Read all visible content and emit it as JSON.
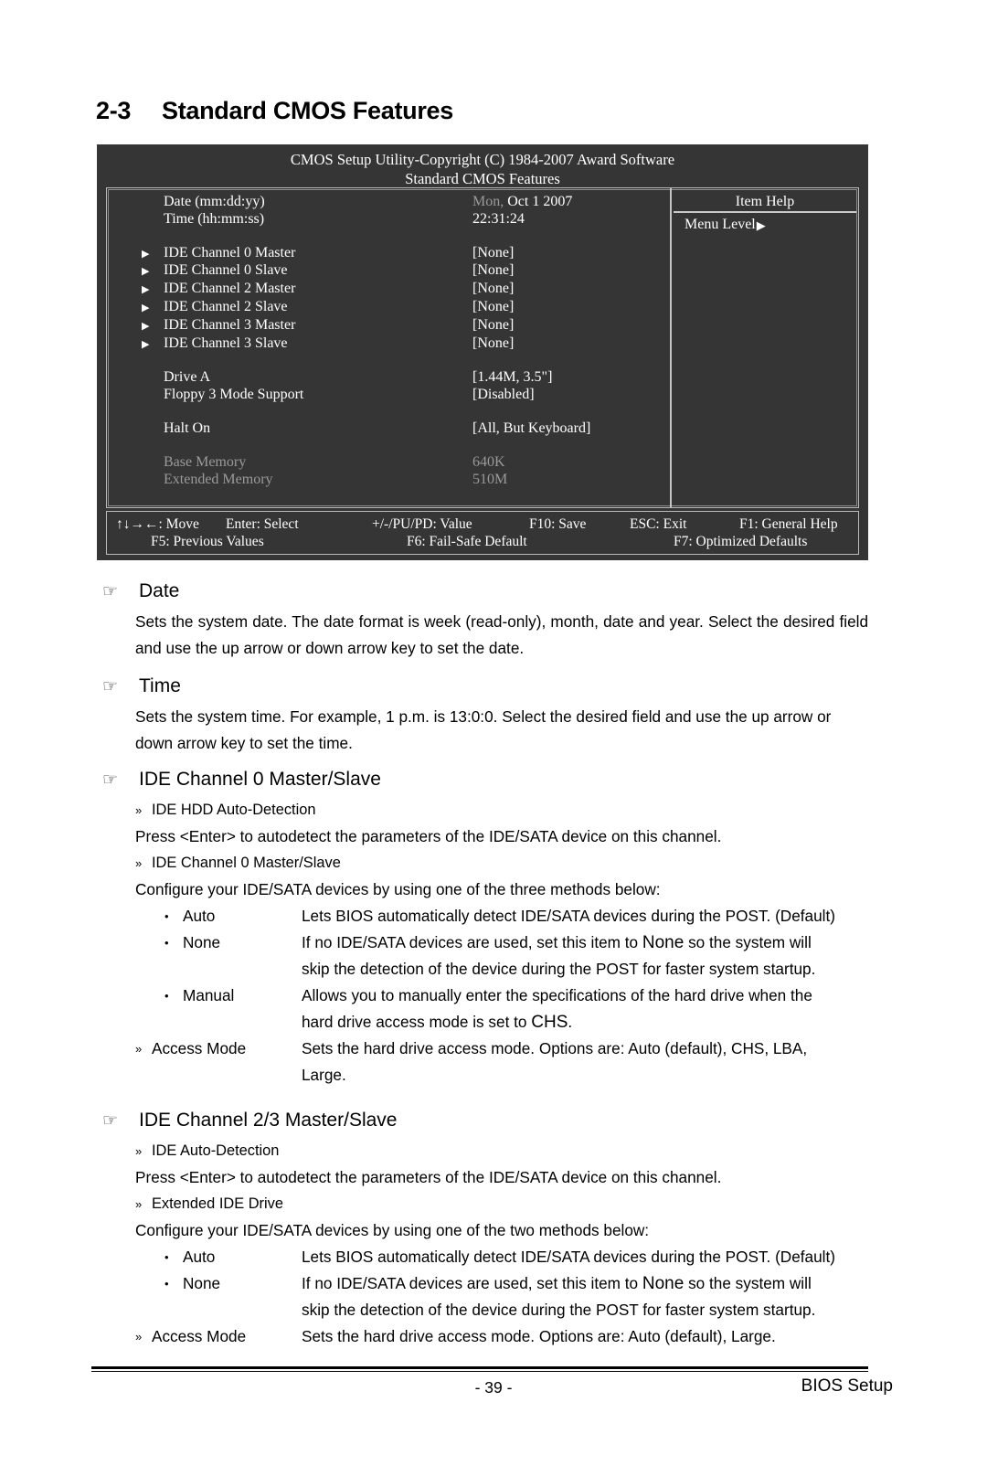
{
  "heading": {
    "number": "2-3",
    "title": "Standard CMOS Features"
  },
  "bios": {
    "title_line1": "CMOS Setup Utility-Copyright (C) 1984-2007 Award Software",
    "title_line2": "Standard CMOS Features",
    "rows": [
      {
        "marker": "",
        "label": "Date (mm:dd:yy)",
        "value_dim": "Mon,",
        "value": "Oct  1  2007"
      },
      {
        "marker": "",
        "label": "Time (hh:mm:ss)",
        "value": "22:31:24"
      },
      {
        "marker": "▶",
        "label": "IDE Channel 0 Master",
        "value": "[None]"
      },
      {
        "marker": "▶",
        "label": "IDE Channel 0 Slave",
        "value": "[None]"
      },
      {
        "marker": "▶",
        "label": "IDE Channel 2 Master",
        "value": "[None]"
      },
      {
        "marker": "▶",
        "label": "IDE Channel 2 Slave",
        "value": "[None]"
      },
      {
        "marker": "▶",
        "label": "IDE Channel 3 Master",
        "value": "[None]"
      },
      {
        "marker": "▶",
        "label": "IDE Channel 3 Slave",
        "value": "[None]"
      },
      {
        "marker": "",
        "label": "Drive A",
        "value": "[1.44M, 3.5\"]"
      },
      {
        "marker": "",
        "label": "Floppy 3 Mode Support",
        "value": "[Disabled]"
      },
      {
        "marker": "",
        "label": "Halt On",
        "value": "[All, But Keyboard]"
      },
      {
        "marker": "",
        "label": "Base Memory",
        "value": "640K",
        "dim": true
      },
      {
        "marker": "",
        "label": "Extended Memory",
        "value": "510M",
        "dim": true
      }
    ],
    "help": {
      "title": "Item Help",
      "menu_level": "Menu Level",
      "menu_arrow": "▶"
    },
    "keys": {
      "move": "↑↓→←: Move",
      "enter": "Enter: Select",
      "value": "+/-/PU/PD: Value",
      "f10": "F10: Save",
      "esc": "ESC: Exit",
      "f1": "F1: General Help",
      "f5": "F5: Previous Values",
      "f6": "F6: Fail-Safe Default",
      "f7": "F7: Optimized Defaults"
    }
  },
  "icons": {
    "hand": "☞",
    "chevron": "»",
    "bullet": "•"
  },
  "sections": {
    "date": {
      "heading": "Date",
      "body": "Sets the system date. The date format is week (read-only), month, date and  year.  Select  the desired field and use the up arrow or down arrow key to set the date."
    },
    "time": {
      "heading": "Time",
      "body": "Sets the system time. For example, 1 p.m. is 13:0:0. Select the desired field and use the up arrow or down arrow key to set the time."
    },
    "ide0": {
      "heading": "IDE Channel 0 Master/Slave",
      "sub1": "IDE HDD Auto-Detection",
      "para1": "Press <Enter> to autodetect the parameters of the IDE/SATA device on this channel.",
      "sub2": "IDE Channel 0 Master/Slave",
      "para2": "Configure your IDE/SATA devices by using one of the three methods below:",
      "options": [
        {
          "name": "Auto",
          "desc": "Lets BIOS automatically detect IDE/SATA devices during the POST. (Default)"
        },
        {
          "name": "None",
          "desc_a": "If no IDE/SATA devices are used, set this item to ",
          "desc_em": "None",
          "desc_b": " so the system will",
          "desc_cont": "skip the detection of the device during the POST for faster system startup."
        },
        {
          "name": "Manual",
          "desc_a": "Allows you to manually enter the specifications of the hard drive when the",
          "desc_cont_a": "hard drive access mode is set to ",
          "desc_cont_em": "CHS",
          "desc_cont_b": "."
        }
      ],
      "access_mode": {
        "name": "Access Mode",
        "desc": "Sets the hard drive access mode. Options are: Auto (default), CHS, LBA,",
        "desc_cont": "Large."
      }
    },
    "ide23": {
      "heading": "IDE Channel 2/3 Master/Slave",
      "sub1": "IDE Auto-Detection",
      "para1": "Press <Enter> to autodetect the parameters of the IDE/SATA device on this channel.",
      "sub2": "Extended IDE Drive",
      "para2": "Configure your IDE/SATA devices by using one of the two methods below:",
      "options": [
        {
          "name": "Auto",
          "desc": "Lets BIOS automatically detect IDE/SATA devices during the POST. (Default)"
        },
        {
          "name": "None",
          "desc_a": "If no IDE/SATA devices are used, set this item to ",
          "desc_em": "None",
          "desc_b": " so the system will",
          "desc_cont": "skip the detection of the device during the POST for faster system startup."
        }
      ],
      "access_mode": {
        "name": "Access Mode",
        "desc": "Sets the hard drive access mode. Options are: Auto (default), Large."
      }
    }
  },
  "footer": {
    "page": "- 39 -",
    "right": "BIOS Setup"
  }
}
